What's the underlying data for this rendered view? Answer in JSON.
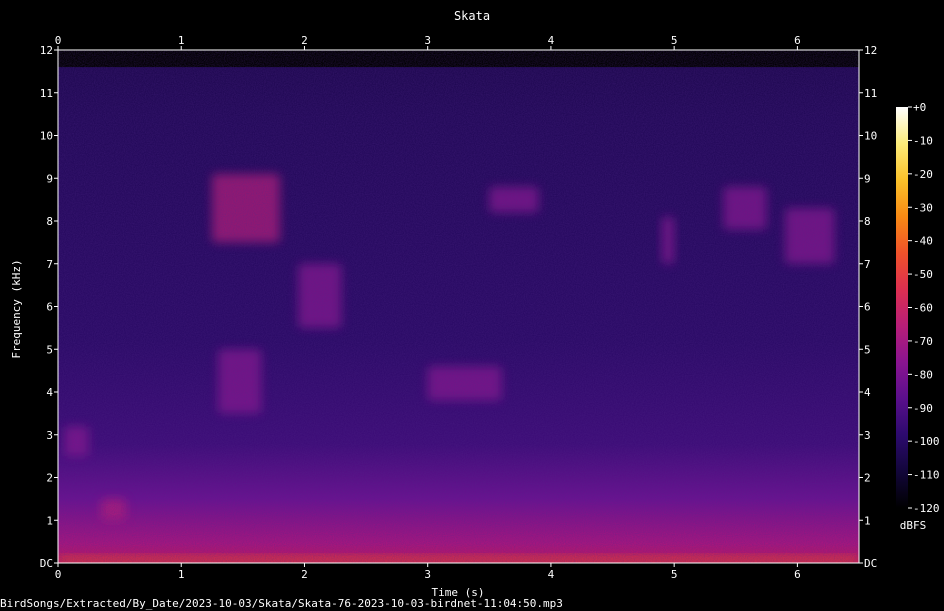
{
  "chart_data": {
    "type": "heatmap",
    "title": "Skata",
    "xlabel": "Time (s)",
    "ylabel": "Frequency (kHz)",
    "xlim": [
      0,
      6.5
    ],
    "ylim": [
      0,
      12
    ],
    "x_ticks": [
      "0",
      "1",
      "2",
      "3",
      "4",
      "5",
      "6"
    ],
    "y_ticks": [
      "DC",
      "1",
      "2",
      "3",
      "4",
      "5",
      "6",
      "7",
      "8",
      "9",
      "10",
      "11",
      "12"
    ],
    "colorbar": {
      "label": "dBFS",
      "range": [
        -120,
        0
      ],
      "ticks": [
        "+0",
        "-10",
        "-20",
        "-30",
        "-40",
        "-50",
        "-60",
        "-70",
        "-80",
        "-90",
        "-100",
        "-110",
        "-120"
      ],
      "colors": [
        "#000000",
        "#12063a",
        "#2c0a6e",
        "#5a0f8c",
        "#8a1490",
        "#b81e78",
        "#dd2f50",
        "#f0522a",
        "#f88a14",
        "#fbc22a",
        "#fcec7a",
        "#ffffff"
      ]
    },
    "grid": false,
    "legend": "none",
    "energy_regions": [
      {
        "t0": 1.25,
        "t1": 1.8,
        "f0": 7.5,
        "f1": 9.1,
        "level_db": -62
      },
      {
        "t0": 1.3,
        "t1": 1.65,
        "f0": 3.5,
        "f1": 5.0,
        "level_db": -75
      },
      {
        "t0": 1.95,
        "t1": 2.3,
        "f0": 5.5,
        "f1": 7.0,
        "level_db": -72
      },
      {
        "t0": 3.0,
        "t1": 3.6,
        "f0": 3.8,
        "f1": 4.6,
        "level_db": -75
      },
      {
        "t0": 3.5,
        "t1": 3.9,
        "f0": 8.2,
        "f1": 8.8,
        "level_db": -78
      },
      {
        "t0": 4.9,
        "t1": 5.0,
        "f0": 7.0,
        "f1": 8.1,
        "level_db": -74
      },
      {
        "t0": 5.4,
        "t1": 5.75,
        "f0": 7.8,
        "f1": 8.8,
        "level_db": -78
      },
      {
        "t0": 5.9,
        "t1": 6.3,
        "f0": 7.0,
        "f1": 8.3,
        "level_db": -76
      },
      {
        "t0": 0.35,
        "t1": 0.55,
        "f0": 1.0,
        "f1": 1.5,
        "level_db": -66
      },
      {
        "t0": 0.05,
        "t1": 0.25,
        "f0": 2.5,
        "f1": 3.2,
        "level_db": -78
      },
      {
        "t0": 0.0,
        "t1": 6.5,
        "f0": 0.0,
        "f1": 0.15,
        "level_db": -45
      }
    ]
  },
  "footer": {
    "file_path": "BirdSongs/Extracted/By_Date/2023-10-03/Skata/Skata-76-2023-10-03-birdnet-11:04:50.mp3"
  }
}
